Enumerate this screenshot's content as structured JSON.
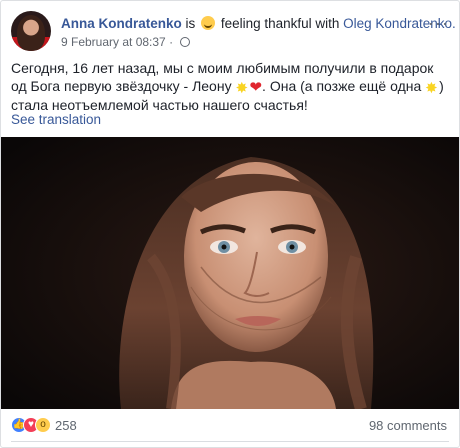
{
  "post": {
    "author": "Anna Kondratenko",
    "is_text": "is",
    "feeling": "feeling thankful with",
    "tagged": "Oleg Kondratenko.",
    "timestamp": "9 February at 08:37",
    "text_part1": "Сегодня, 16 лет назад, мы с моим любимым получили в подарок од Бога первую звёздочку - Леону",
    "text_part2": ". Она (а позже ещё одна",
    "text_part3": ") стала неотъемлемой частью нашего счастья!",
    "see_translation": "See translation"
  },
  "footer": {
    "reaction_count": "258",
    "comments": "98 comments"
  },
  "icons": {
    "feeling": "smiling-face-icon",
    "star": "glowing-star-icon",
    "heart": "red-heart-icon",
    "privacy": "globe-icon",
    "more": "more-dots-icon",
    "reactions": [
      "like-icon",
      "love-icon",
      "wow-icon"
    ]
  },
  "colors": {
    "link": "#385898",
    "muted": "#616770",
    "love": "#f33e58",
    "like": "#4080ff"
  }
}
